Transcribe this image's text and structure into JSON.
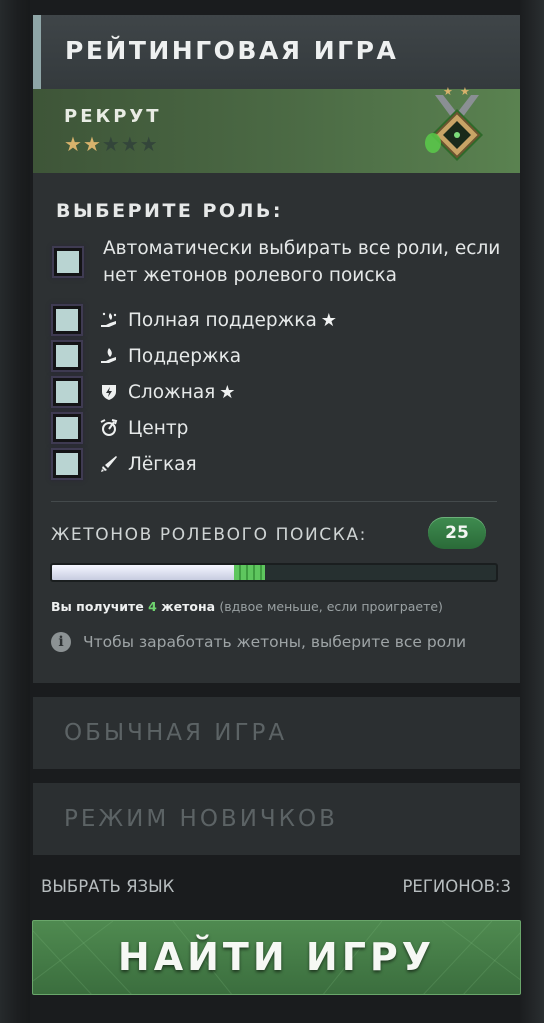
{
  "ranked": {
    "title": "РЕЙТИНГОВАЯ ИГРА",
    "rank_name": "РЕКРУТ",
    "rank_stars_total": 5,
    "rank_stars_filled": 2,
    "medal_stars": 2
  },
  "roles": {
    "title": "ВЫБЕРИТЕ РОЛЬ:",
    "auto_select_label": "Автоматически выбирать все роли, если нет жетонов ролевого поиска",
    "items": [
      {
        "label": "Полная поддержка",
        "icon": "full-support-icon",
        "starred": true
      },
      {
        "label": "Поддержка",
        "icon": "support-icon",
        "starred": false
      },
      {
        "label": "Сложная",
        "icon": "offlane-icon",
        "starred": true
      },
      {
        "label": "Центр",
        "icon": "midlane-icon",
        "starred": false
      },
      {
        "label": "Лёгкая",
        "icon": "safelane-icon",
        "starred": false
      }
    ]
  },
  "tokens": {
    "label": "ЖЕТОНОВ РОЛЕВОГО ПОИСКА:",
    "count": "25",
    "progress_fraction": 0.41,
    "gain_fraction": 0.07,
    "earn_prefix": "Вы получите",
    "earn_number": "4",
    "earn_suffix": "жетона",
    "earn_note": "(вдвое меньше, если проиграете)",
    "hint": "Чтобы заработать жетоны, выберите все роли"
  },
  "modes": {
    "normal": "ОБЫЧНАЯ ИГРА",
    "newbie": "РЕЖИМ НОВИЧКОВ"
  },
  "footer": {
    "language": "ВЫБРАТЬ ЯЗЫК",
    "regions": "РЕГИОНОВ:3"
  },
  "find_button": "НАЙТИ ИГРУ",
  "colors": {
    "accent_green": "#3f8c50",
    "rank_star": "#d8b26c",
    "checkbox": "#b9d4d2"
  }
}
